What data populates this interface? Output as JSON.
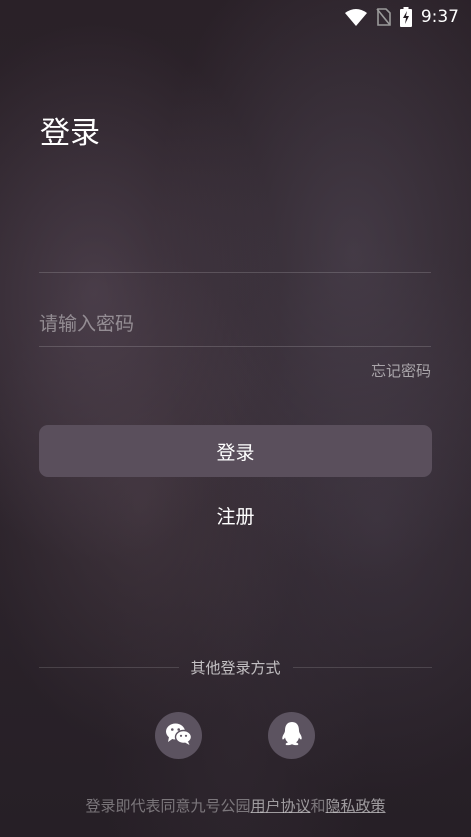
{
  "status_bar": {
    "time": "9:37"
  },
  "login": {
    "title": "登录",
    "username_value": "",
    "username_placeholder": "",
    "password_placeholder": "请输入密码",
    "forgot_password": "忘记密码",
    "login_button": "登录",
    "register": "注册"
  },
  "other_login": {
    "label": "其他登录方式",
    "icons": [
      "wechat-icon",
      "qq-icon"
    ]
  },
  "footer": {
    "prefix": "登录即代表同意九号公园",
    "user_agreement": "用户协议",
    "and": "和",
    "privacy_policy": "隐私政策"
  },
  "colors": {
    "background": "#231c22",
    "button": "#5a4f5c",
    "social_circle": "#5c5360"
  }
}
